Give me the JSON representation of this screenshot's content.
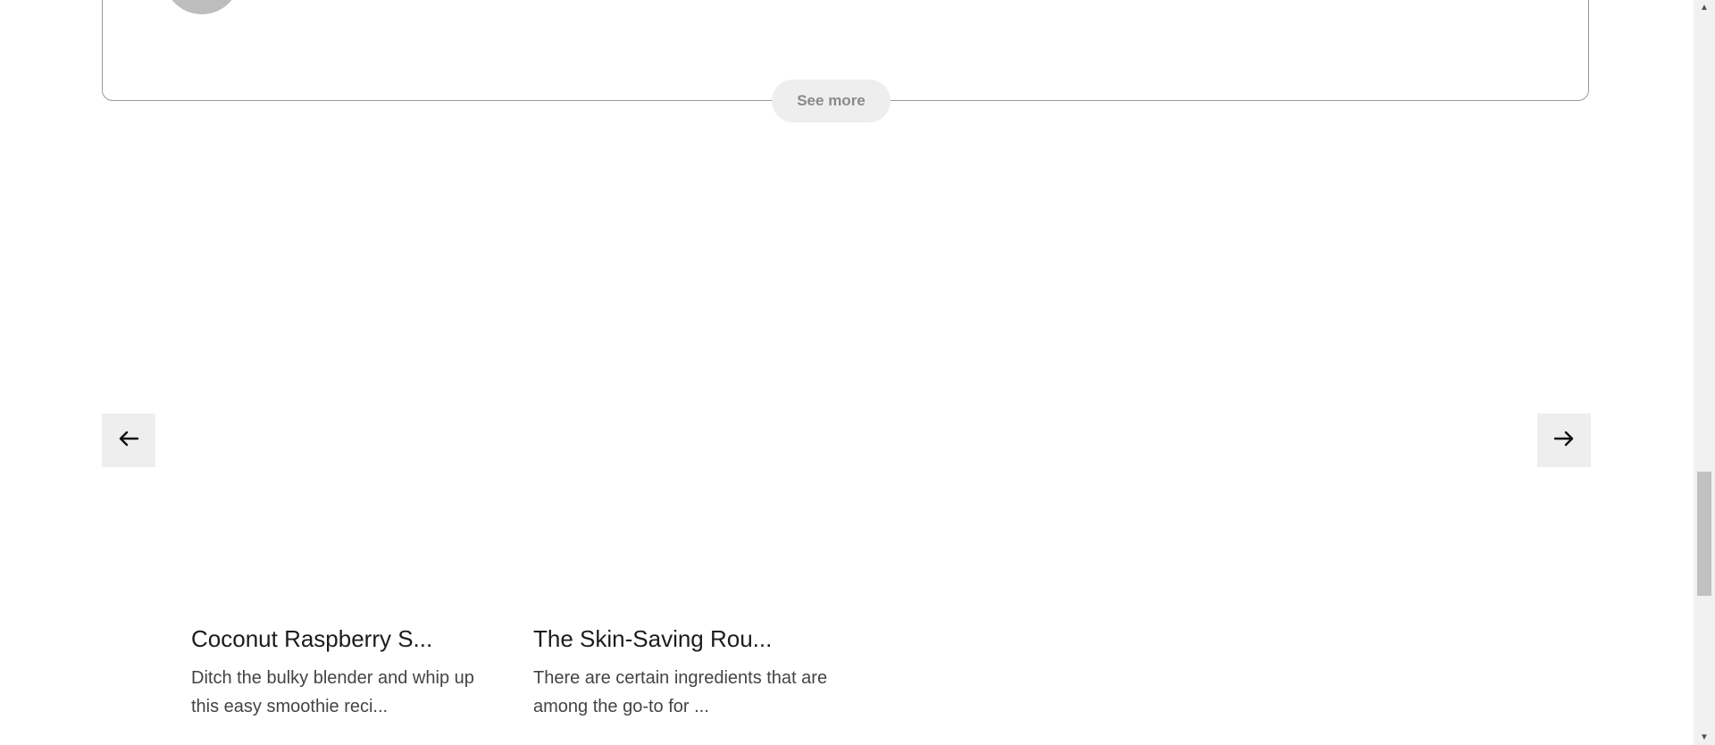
{
  "reviews": {
    "see_more_label": "See more"
  },
  "carousel": {
    "prev_icon": "arrow-left-icon",
    "next_icon": "arrow-right-icon",
    "articles": [
      {
        "title": "Coconut Raspberry S...",
        "excerpt": "Ditch the bulky blender and whip up this easy smoothie reci..."
      },
      {
        "title": "The Skin-Saving Rou...",
        "excerpt": "There are certain ingredients that are among the go-to for ..."
      }
    ]
  },
  "colors": {
    "card_border": "#9a9a9a",
    "button_bg": "#eeeeee",
    "button_text": "#8a8a8a",
    "avatar": "#bdbdbd"
  }
}
